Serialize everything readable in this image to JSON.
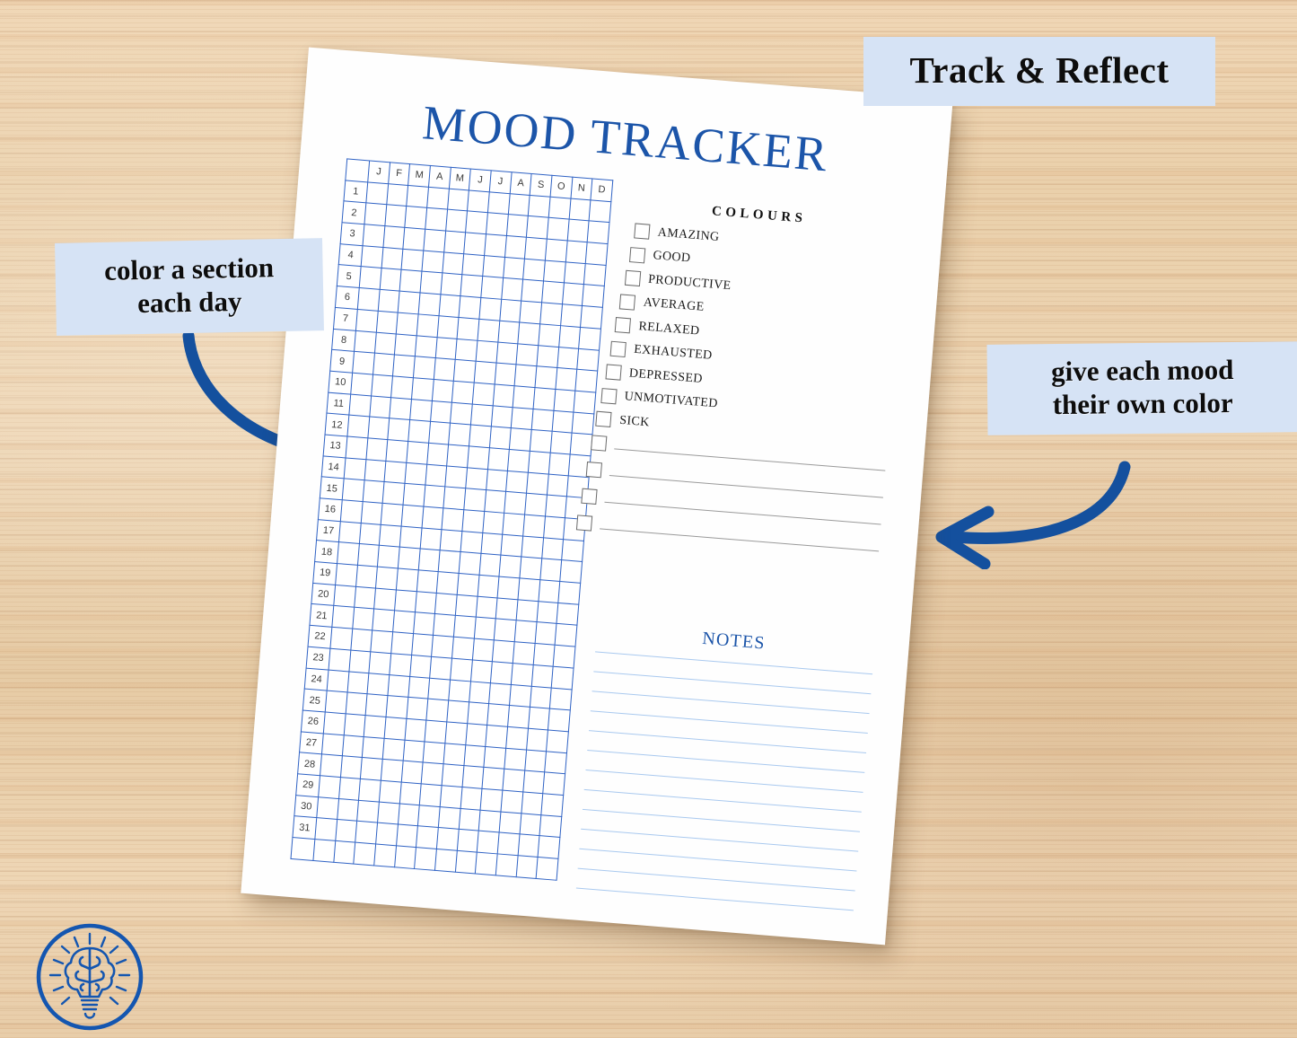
{
  "meta": {
    "accent_blue": "#1c55a9",
    "grid_blue": "#2f62c4",
    "callout_bg": "#d6e3f5",
    "corner_cell_color": "#4b4b4b",
    "note_line_color": "#a9c9ef",
    "wood_base": "#ead0ab"
  },
  "callouts": {
    "top": "Track & Reflect",
    "left": "color a section\neach day",
    "left_line1": "color a section",
    "left_line2": "each day",
    "right_line1": "give each mood",
    "right_line2": "their own color"
  },
  "printable": {
    "title": "MOOD TRACKER",
    "grid": {
      "corner_label": "",
      "months": [
        "J",
        "F",
        "M",
        "A",
        "M",
        "J",
        "J",
        "A",
        "S",
        "O",
        "N",
        "D"
      ],
      "days": [
        1,
        2,
        3,
        4,
        5,
        6,
        7,
        8,
        9,
        10,
        11,
        12,
        13,
        14,
        15,
        16,
        17,
        18,
        19,
        20,
        21,
        22,
        23,
        24,
        25,
        26,
        27,
        28,
        29,
        30,
        31
      ],
      "extra_blank_row": true
    },
    "colours": {
      "heading": "COLOURS",
      "items": [
        "AMAZING",
        "GOOD",
        "PRODUCTIVE",
        "AVERAGE",
        "RELAXED",
        "EXHAUSTED",
        "DEPRESSED",
        "UNMOTIVATED",
        "SICK"
      ],
      "blank_rows": 4
    },
    "notes": {
      "heading": "NOTES",
      "line_count": 13
    }
  },
  "logo": {
    "name": "brain-lightbulb-logo"
  }
}
